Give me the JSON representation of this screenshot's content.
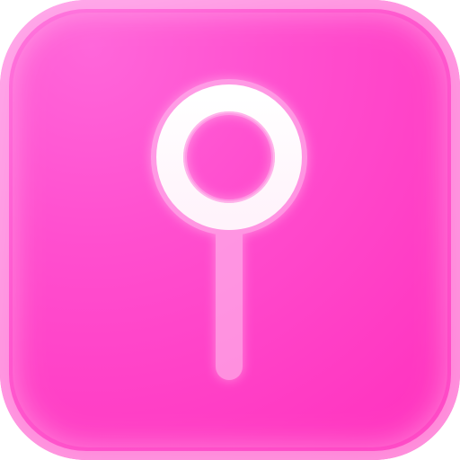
{
  "icon": {
    "name": "pin-icon",
    "colors": {
      "background_top": "#ff66da",
      "background_bottom": "#ff2fbd",
      "glyph": "#ffffff",
      "glyph_shadow": "#ff8ee6"
    }
  }
}
